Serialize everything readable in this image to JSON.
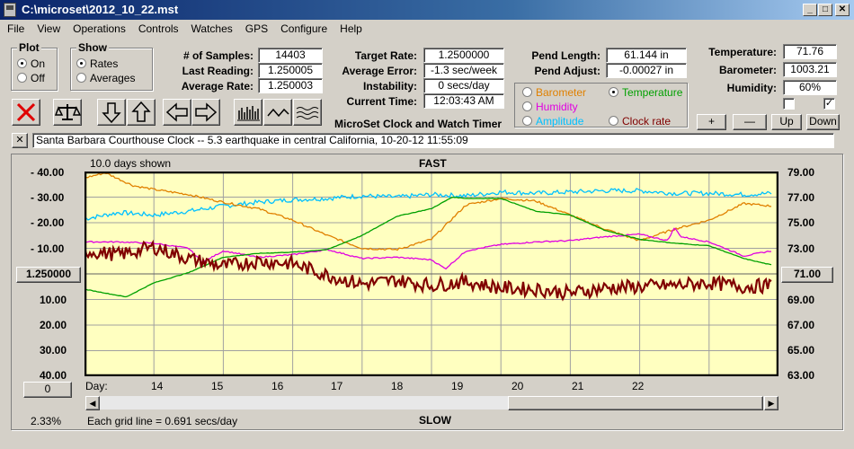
{
  "window": {
    "title": "C:\\microset\\2012_10_22.mst"
  },
  "menu": [
    "File",
    "View",
    "Operations",
    "Controls",
    "Watches",
    "GPS",
    "Configure",
    "Help"
  ],
  "plot_group": {
    "title": "Plot",
    "on": "On",
    "off": "Off",
    "selected": "On"
  },
  "show_group": {
    "title": "Show",
    "rates": "Rates",
    "averages": "Averages",
    "selected": "Rates"
  },
  "stats": {
    "samples_label": "# of Samples:",
    "samples": "14403",
    "last_reading_label": "Last Reading:",
    "last_reading": "1.250005",
    "average_rate_label": "Average Rate:",
    "average_rate": "1.250003",
    "target_rate_label": "Target Rate:",
    "target_rate": "1.2500000",
    "average_error_label": "Average Error:",
    "average_error": "-1.3 sec/week",
    "instability_label": "Instability:",
    "instability": "0 secs/day",
    "current_time_label": "Current Time:",
    "current_time": "12:03:43 AM",
    "pend_length_label": "Pend Length:",
    "pend_length": "61.144 in",
    "pend_adjust_label": "Pend Adjust:",
    "pend_adjust": "-0.00027 in",
    "temperature_label": "Temperature:",
    "temperature": "71.76",
    "barometer_label": "Barometer:",
    "barometer": "1003.21",
    "humidity_label": "Humidity:",
    "humidity": "60%"
  },
  "series_select": {
    "barometer": "Barometer",
    "temperature": "Temperature",
    "humidity": "Humidity",
    "amplitude": "Amplitude",
    "clock_rate": "Clock rate",
    "selected": "Temperature"
  },
  "app_name": "MicroSet Clock and Watch Timer",
  "adjust_buttons": {
    "plus": "+",
    "minus": "—",
    "up": "Up",
    "down": "Down"
  },
  "checkboxes": [
    false,
    true
  ],
  "note": {
    "close": "✕",
    "text": "Santa Barbara Courthouse Clock   --  5.3 earthquake in central California, 10-20-12 11:55:09"
  },
  "chart_header": {
    "days_shown": "10.0 days shown",
    "top_label": "FAST",
    "bottom_label": "SLOW"
  },
  "left_center_button": "1.250000",
  "right_center_button": "71.00",
  "offset_button": "0",
  "zoom_percent": "2.33%",
  "grid_info": "Each grid line = 0.691 secs/day",
  "day_prefix": "Day:",
  "colors": {
    "plot_bg": "#ffffc0",
    "clock_rate": "#800000",
    "temperature": "#00c0ff",
    "barometer": "#e08000",
    "humidity": "#e000e0",
    "amplitude": "#00a000"
  },
  "chart_data": {
    "type": "line",
    "x_label": "Day",
    "x_ticks": [
      "14",
      "15",
      "16",
      "17",
      "18",
      "19",
      "20",
      "21",
      "22"
    ],
    "xlim": [
      13.0,
      23.0
    ],
    "left_ticks": [
      "- 40.00",
      "- 30.00",
      "- 20.00",
      "- 10.00",
      "10.00",
      "20.00",
      "30.00",
      "40.00"
    ],
    "right_ticks": [
      "79.00",
      "77.00",
      "75.00",
      "73.00",
      "71.00",
      "69.00",
      "67.00",
      "65.00",
      "63.00"
    ],
    "right_ylim": [
      63,
      79
    ],
    "series": [
      {
        "name": "Temperature",
        "color": "#00c0ff",
        "x": [
          13.0,
          13.5,
          14.0,
          14.5,
          15.0,
          15.5,
          16.0,
          16.5,
          17.0,
          17.5,
          18.0,
          18.5,
          19.0,
          19.5,
          20.0,
          20.5,
          21.0,
          21.5,
          22.0,
          22.5,
          22.9
        ],
        "y": [
          75.3,
          75.8,
          75.6,
          75.9,
          76.3,
          76.6,
          76.8,
          76.9,
          77.1,
          77.0,
          77.2,
          77.1,
          77.4,
          77.3,
          77.4,
          77.5,
          77.5,
          77.3,
          77.3,
          77.2,
          77.3
        ]
      },
      {
        "name": "Barometer",
        "color": "#e08000",
        "x": [
          13.0,
          13.3,
          13.7,
          14.0,
          14.5,
          15.0,
          15.5,
          16.0,
          16.5,
          17.0,
          17.5,
          18.0,
          18.5,
          19.0,
          19.5,
          20.0,
          20.5,
          21.0,
          21.5,
          22.0,
          22.5,
          22.9
        ],
        "y": [
          78.5,
          78.9,
          77.9,
          77.6,
          77.2,
          76.6,
          76.1,
          75.2,
          74.0,
          73.0,
          72.9,
          73.7,
          76.4,
          76.9,
          76.7,
          75.6,
          74.5,
          73.6,
          74.5,
          75.2,
          76.5,
          76.3
        ]
      },
      {
        "name": "Humidity",
        "color": "#e000e0",
        "x": [
          13.0,
          13.5,
          14.0,
          14.5,
          14.7,
          15.0,
          15.5,
          16.0,
          16.5,
          17.0,
          17.5,
          18.0,
          18.2,
          18.5,
          19.0,
          19.5,
          20.0,
          20.5,
          21.0,
          21.4,
          21.5,
          21.6,
          22.0,
          22.5,
          22.9
        ],
        "y": [
          73.5,
          73.5,
          73.4,
          73.0,
          71.9,
          72.8,
          72.3,
          72.5,
          72.9,
          72.2,
          72.3,
          72.1,
          71.4,
          72.8,
          73.3,
          73.5,
          73.6,
          73.9,
          74.1,
          73.6,
          74.6,
          73.9,
          73.5,
          72.4,
          72.8
        ]
      },
      {
        "name": "Amplitude",
        "color": "#00a000",
        "x": [
          13.0,
          13.3,
          13.6,
          14.0,
          14.5,
          15.0,
          15.5,
          16.0,
          16.5,
          17.0,
          17.5,
          18.0,
          18.3,
          18.5,
          19.0,
          19.5,
          20.0,
          20.5,
          21.0,
          21.5,
          22.0,
          22.5,
          22.9
        ],
        "y": [
          69.8,
          69.5,
          69.2,
          70.3,
          71.1,
          72.3,
          72.6,
          72.7,
          72.9,
          74.0,
          75.5,
          76.1,
          77.0,
          76.9,
          76.9,
          75.9,
          75.6,
          74.4,
          73.7,
          73.4,
          73.2,
          72.2,
          71.7
        ]
      },
      {
        "name": "Clock rate",
        "color": "#800000",
        "x": [
          13.0,
          13.5,
          14.0,
          14.5,
          15.0,
          15.5,
          16.0,
          16.5,
          17.0,
          17.5,
          18.0,
          18.5,
          19.0,
          19.5,
          20.0,
          20.5,
          21.0,
          21.5,
          22.0,
          22.5,
          22.9
        ],
        "y": [
          72.8,
          72.5,
          73.1,
          72.2,
          71.6,
          72.0,
          71.8,
          70.9,
          70.2,
          70.5,
          70.1,
          70.4,
          69.9,
          69.8,
          69.5,
          69.9,
          70.0,
          70.1,
          70.3,
          70.0,
          70.1
        ]
      }
    ]
  }
}
